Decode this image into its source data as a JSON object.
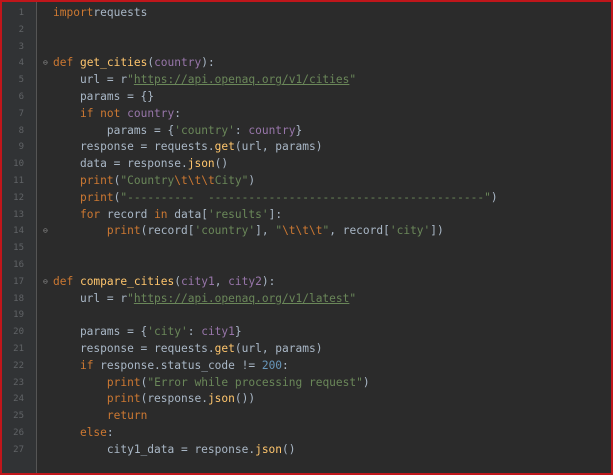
{
  "editor": {
    "line_numbers": [
      "1",
      "2",
      "3",
      "4",
      "5",
      "6",
      "7",
      "8",
      "9",
      "10",
      "11",
      "12",
      "13",
      "14",
      "15",
      "16",
      "17",
      "18",
      "19",
      "20",
      "21",
      "22",
      "23",
      "24",
      "25",
      "26",
      "27"
    ],
    "colors": {
      "background": "#2b2b2b",
      "gutter": "#313335",
      "border": "#c0161b",
      "keyword": "#cc7832",
      "function": "#ffc66d",
      "string": "#6a8759",
      "number": "#6897bb",
      "default": "#a9b7c6"
    },
    "lines": [
      [
        [
          "kw",
          "import"
        ],
        [
          "",
          "requests"
        ]
      ],
      [],
      [],
      [
        [
          "kw",
          "def "
        ],
        [
          "fn",
          "get_cities"
        ],
        [
          "",
          "("
        ],
        [
          "hl",
          "country"
        ],
        [
          "",
          "):"
        ]
      ],
      [
        [
          "",
          "    url = r"
        ],
        [
          "str",
          "\""
        ],
        [
          "url",
          "https://api.openaq.org/v1/cities"
        ],
        [
          "str",
          "\""
        ]
      ],
      [
        [
          "",
          "    params = {}"
        ]
      ],
      [
        [
          "",
          "    "
        ],
        [
          "kw",
          "if not "
        ],
        [
          "hl",
          "country"
        ],
        [
          "",
          ":"
        ]
      ],
      [
        [
          "",
          "        params = {"
        ],
        [
          "str",
          "'country'"
        ],
        [
          "",
          ": "
        ],
        [
          "hl",
          "country"
        ],
        [
          "",
          "}"
        ]
      ],
      [
        [
          "",
          "    response = requests."
        ],
        [
          "fn",
          "get"
        ],
        [
          "",
          "(url, params)"
        ]
      ],
      [
        [
          "",
          "    data = response."
        ],
        [
          "fn",
          "json"
        ],
        [
          "",
          "()"
        ]
      ],
      [
        [
          "",
          "    "
        ],
        [
          "kw",
          "print"
        ],
        [
          "",
          "("
        ],
        [
          "str",
          "\"Country"
        ],
        [
          "esc",
          "\\t\\t\\t"
        ],
        [
          "str",
          "City\""
        ],
        [
          "",
          ")"
        ]
      ],
      [
        [
          "",
          "    "
        ],
        [
          "kw",
          "print"
        ],
        [
          "",
          "("
        ],
        [
          "str",
          "\"----------  -----------------------------------------\""
        ],
        [
          "",
          ")"
        ]
      ],
      [
        [
          "",
          "    "
        ],
        [
          "kw",
          "for "
        ],
        [
          "",
          "record "
        ],
        [
          "kw",
          "in "
        ],
        [
          "",
          "data["
        ],
        [
          "str",
          "'results'"
        ],
        [
          "",
          "]:"
        ]
      ],
      [
        [
          "",
          "        "
        ],
        [
          "kw",
          "print"
        ],
        [
          "",
          "(record["
        ],
        [
          "str",
          "'country'"
        ],
        [
          "",
          "], "
        ],
        [
          "str",
          "\""
        ],
        [
          "esc",
          "\\t\\t\\t"
        ],
        [
          "str",
          "\""
        ],
        [
          "",
          ", record["
        ],
        [
          "str",
          "'city'"
        ],
        [
          "",
          "])"
        ]
      ],
      [],
      [],
      [
        [
          "kw",
          "def "
        ],
        [
          "fn",
          "compare_cities"
        ],
        [
          "",
          "("
        ],
        [
          "hl",
          "city1"
        ],
        [
          "",
          ", "
        ],
        [
          "hl",
          "city2"
        ],
        [
          "",
          "):"
        ]
      ],
      [
        [
          "",
          "    url = r"
        ],
        [
          "str",
          "\""
        ],
        [
          "url",
          "https://api.openaq.org/v1/latest"
        ],
        [
          "str",
          "\""
        ]
      ],
      [],
      [
        [
          "",
          "    params = {"
        ],
        [
          "str",
          "'city'"
        ],
        [
          "",
          ": "
        ],
        [
          "hl",
          "city1"
        ],
        [
          "",
          "}"
        ]
      ],
      [
        [
          "",
          "    response = requests."
        ],
        [
          "fn",
          "get"
        ],
        [
          "",
          "(url, params)"
        ]
      ],
      [
        [
          "",
          "    "
        ],
        [
          "kw",
          "if "
        ],
        [
          "",
          "response.status_code != "
        ],
        [
          "num",
          "200"
        ],
        [
          "",
          ":"
        ]
      ],
      [
        [
          "",
          "        "
        ],
        [
          "kw",
          "print"
        ],
        [
          "",
          "("
        ],
        [
          "str",
          "\"Error while processing request\""
        ],
        [
          "",
          ")"
        ]
      ],
      [
        [
          "",
          "        "
        ],
        [
          "kw",
          "print"
        ],
        [
          "",
          "(response."
        ],
        [
          "fn",
          "json"
        ],
        [
          "",
          "())"
        ]
      ],
      [
        [
          "",
          "        "
        ],
        [
          "kw",
          "return"
        ]
      ],
      [
        [
          "",
          "    "
        ],
        [
          "kw",
          "else"
        ],
        [
          "",
          ":"
        ]
      ],
      [
        [
          "",
          "        city1_data = response."
        ],
        [
          "fn",
          "json"
        ],
        [
          "",
          "()"
        ]
      ]
    ],
    "fold_markers": {
      "3": "⊖",
      "13": "⊖",
      "16": "⊖"
    }
  }
}
